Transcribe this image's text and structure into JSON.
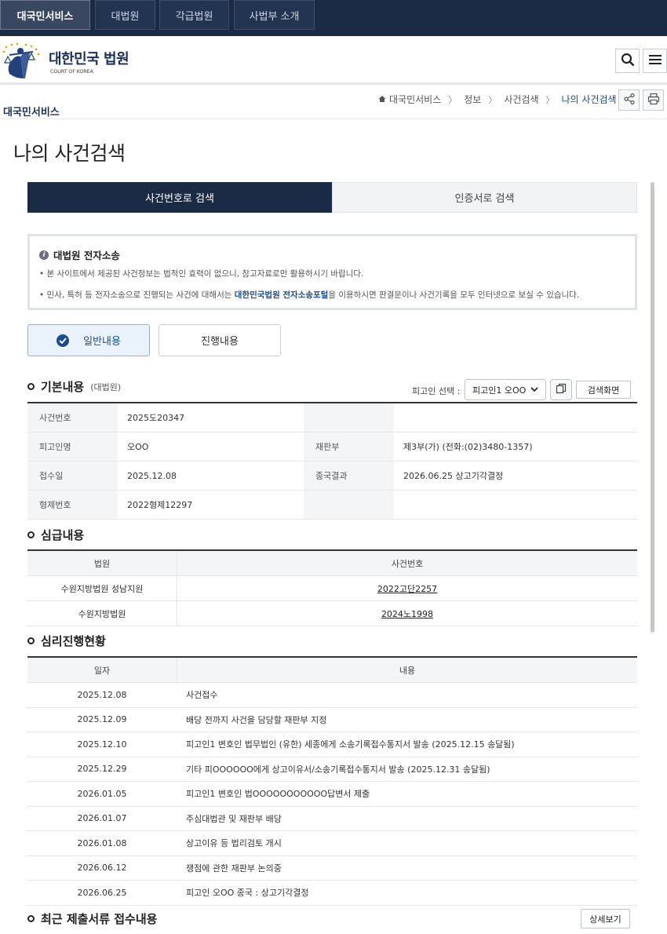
{
  "topnav": {
    "tabs": [
      {
        "label": "대국민서비스",
        "active": true
      },
      {
        "label": "대법원",
        "active": false
      },
      {
        "label": "각급법원",
        "active": false
      },
      {
        "label": "사법부 소개",
        "active": false
      }
    ]
  },
  "header": {
    "logo_title": "대한민국 법원",
    "logo_sub": "COURT OF KOREA",
    "search_icon": "search-icon",
    "menu_icon": "menu-icon"
  },
  "subheader": {
    "section_label": "대국민서비스",
    "breadcrumb": [
      "대국민서비스",
      "정보",
      "사건검색",
      "나의 사건검색"
    ],
    "share_icon": "share-icon",
    "print_icon": "print-icon"
  },
  "page_title": "나의 사건검색",
  "search_tabs": {
    "by_number": "사건번호로 검색",
    "by_cert": "인증서로 검색"
  },
  "notice": {
    "title": "대법원 전자소송",
    "line1": "• 본 사이트에서 제공된 사건정보는 법적인 효력이 없으니, 참고자료로만 활용하시기 바랍니다.",
    "line2_pre": "• 민사, 특허 등 전자소송으로 진행되는 사건에 대해서는 ",
    "line2_link": "대한민국법원 전자소송포털",
    "line2_post": "을 이용하시면 판결문이나 사건기록을 모두 인터넷으로 보실 수 있습니다."
  },
  "view_toggle": {
    "general": "일반내용",
    "progress": "진행내용"
  },
  "basic": {
    "title": "기본내용",
    "sub": "(대법원)",
    "select_label": "피고인 선택 :",
    "select_value": "피고인1 오OO",
    "search_screen_btn": "검색화면",
    "rows": [
      {
        "l1": "사건번호",
        "v1": "2025도20347",
        "l2": "",
        "v2": ""
      },
      {
        "l1": "피고인명",
        "v1": "오OO",
        "l2": "재판부",
        "v2": "제3부(가) (전화:(02)3480-1357)"
      },
      {
        "l1": "접수일",
        "v1": "2025.12.08",
        "l2": "종국결과",
        "v2": "2026.06.25 상고기각결정"
      },
      {
        "l1": "형제번호",
        "v1": "2022형제12297",
        "l2": "",
        "v2": ""
      }
    ]
  },
  "lower": {
    "title": "심급내용",
    "headers": [
      "법원",
      "사건번호"
    ],
    "rows": [
      {
        "court": "수원지방법원 성남지원",
        "case": "2022고단2257"
      },
      {
        "court": "수원지방법원",
        "case": "2024노1998"
      }
    ]
  },
  "hearing": {
    "title": "심리진행현황",
    "headers": [
      "일자",
      "내용"
    ],
    "rows": [
      {
        "date": "2025.12.08",
        "content": "사건접수"
      },
      {
        "date": "2025.12.09",
        "content": "배당 전까지 사건을 담당할 재판부 지정"
      },
      {
        "date": "2025.12.10",
        "content": "피고인1 변호인 법무법인 (유한) 세종에게 소송기록접수통지서 발송 (2025.12.15 송달됨)"
      },
      {
        "date": "2025.12.29",
        "content": "기타 피OOOOOO에게 상고이유서/소송기록접수통지서 발송 (2025.12.31 송달됨)"
      },
      {
        "date": "2026.01.05",
        "content": "피고인1 변호인 법OOOOOOOOOOO답변서 제출"
      },
      {
        "date": "2026.01.07",
        "content": "주심대법관 및 재판부 배당"
      },
      {
        "date": "2026.01.08",
        "content": "상고이유 등 법리검토 개시"
      },
      {
        "date": "2026.06.12",
        "content": "쟁점에 관한 재판부 논의중"
      },
      {
        "date": "2026.06.25",
        "content": "피고인 오OO 종국 : 상고기각결정"
      }
    ]
  },
  "recent": {
    "title": "최근 제출서류 접수내용",
    "detail_btn": "상세보기"
  }
}
